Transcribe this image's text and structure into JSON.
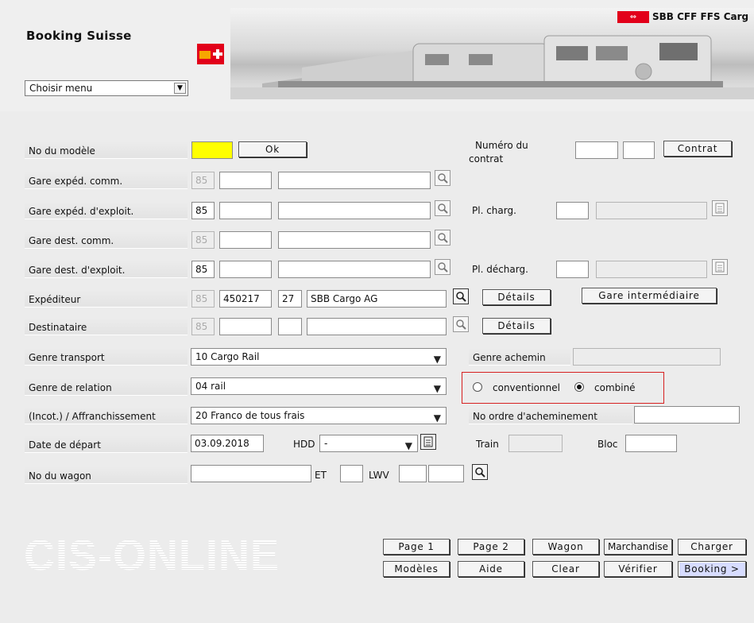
{
  "header": {
    "app_title": "Booking Suisse",
    "brand_text": "SBB CFF FFS Carg",
    "menu_select_value": "Choisir menu"
  },
  "form": {
    "modele": {
      "label": "No du modèle",
      "ok_label": "Ok"
    },
    "contrat": {
      "label_line1": "Numéro du",
      "label_line2": "contrat",
      "button": "Contrat"
    },
    "gare_exped_comm": {
      "label": "Gare expéd. comm.",
      "prefix": "85"
    },
    "gare_exped_exploit": {
      "label": "Gare expéd. d'exploit.",
      "prefix": "85"
    },
    "pl_charg": {
      "label": "Pl. charg."
    },
    "gare_dest_comm": {
      "label": "Gare dest. comm.",
      "prefix": "85"
    },
    "gare_dest_exploit": {
      "label": "Gare dest. d'exploit.",
      "prefix": "85"
    },
    "pl_decharg": {
      "label": "Pl. décharg."
    },
    "expediteur": {
      "label": "Expéditeur",
      "prefix": "85",
      "number": "450217",
      "code": "27",
      "name": "SBB Cargo AG",
      "details": "Détails"
    },
    "gare_intermediaire": "Gare intermédiaire",
    "destinataire": {
      "label": "Destinataire",
      "prefix": "85",
      "details": "Détails"
    },
    "genre_transport": {
      "label": "Genre transport",
      "value": "10 Cargo Rail"
    },
    "genre_achemin": {
      "label": "Genre achemin"
    },
    "genre_relation": {
      "label": "Genre de relation",
      "value": "04 rail"
    },
    "radio": {
      "option1": "conventionnel",
      "option2": "combiné",
      "selected": "combiné"
    },
    "affranchissement": {
      "label": "(Incot.) / Affranchissement",
      "value": "20 Franco de tous frais"
    },
    "no_ordre": {
      "label": "No ordre d'acheminement"
    },
    "date_depart": {
      "label": "Date de départ",
      "value": "03.09.2018",
      "hdd_label": "HDD",
      "hdd_value": "-"
    },
    "train": {
      "label": "Train"
    },
    "bloc": {
      "label": "Bloc"
    },
    "wagon": {
      "label": "No du wagon",
      "et_label": "ET",
      "lwv_label": "LWV"
    }
  },
  "footer": {
    "logo_text": "CIS-ONLINE",
    "buttons_row1": [
      "Page 1",
      "Page 2",
      "Wagon",
      "Marchandise",
      "Charger"
    ],
    "buttons_row2": [
      "Modèles",
      "Aide",
      "Clear",
      "Vérifier",
      "Booking >"
    ],
    "active_button": "Booking >"
  },
  "colors": {
    "brand_red": "#e2001a",
    "highlight_yellow": "#ffff00",
    "radio_box_border": "#d62020",
    "active_button_bg": "#d7dcff"
  },
  "icons": [
    "swiss-cross-icon",
    "sbb-logo-icon",
    "magnifier-icon",
    "document-icon",
    "dropdown-arrow-icon"
  ]
}
